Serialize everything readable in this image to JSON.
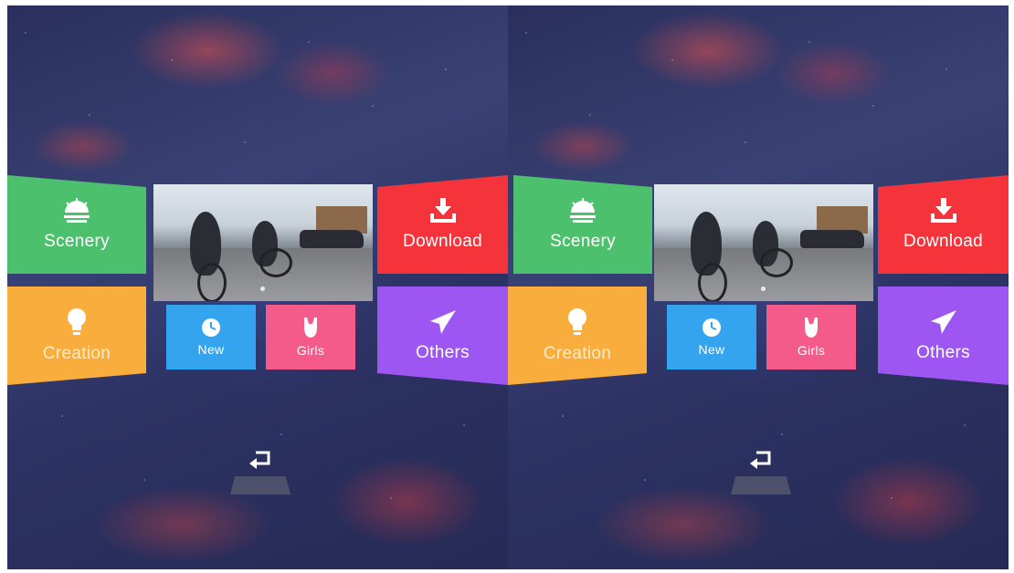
{
  "app": {
    "tiles": {
      "scenery": {
        "label": "Scenery",
        "color": "#4cc06c",
        "icon": "sunset-icon"
      },
      "creation": {
        "label": "Creation",
        "color": "#f8ad3c",
        "icon": "lightbulb-icon"
      },
      "download": {
        "label": "Download",
        "color": "#f4343a",
        "icon": "download-icon"
      },
      "others": {
        "label": "Others",
        "color": "#9e56f2",
        "icon": "paper-plane-icon"
      },
      "new": {
        "label": "New",
        "color": "#34a4ee",
        "icon": "clock-icon"
      },
      "girls": {
        "label": "Girls",
        "color": "#f45b8a",
        "icon": "swimsuit-icon"
      }
    },
    "featured": {
      "content": "cycling video thumbnail",
      "carousel_index": 1,
      "carousel_count": 1
    },
    "back": {
      "icon": "return-arrow-icon"
    }
  }
}
